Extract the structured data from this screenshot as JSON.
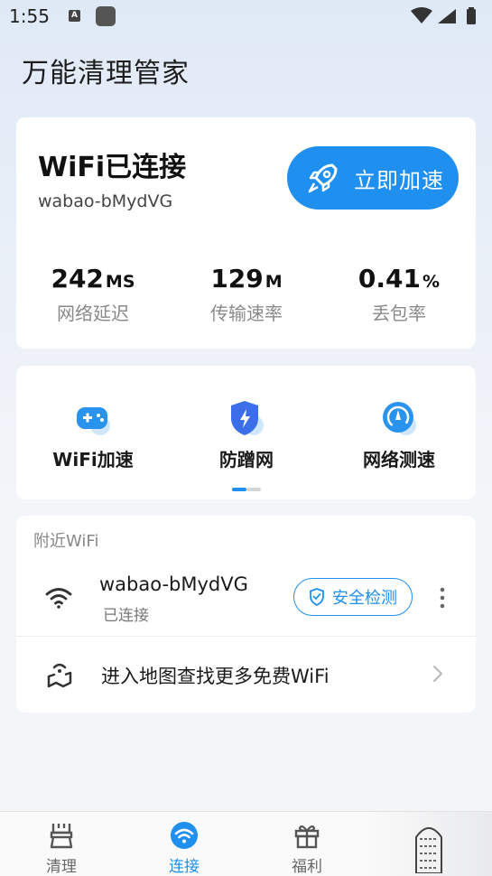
{
  "status_bar": {
    "time": "1:55",
    "notification_badge": "A"
  },
  "app": {
    "title": "万能清理管家"
  },
  "connection": {
    "status": "WiFi已连接",
    "ssid": "wabao-bMydVG",
    "boost_label": "立即加速",
    "stats": [
      {
        "value": "242",
        "unit": "MS",
        "label": "网络延迟"
      },
      {
        "value": "129",
        "unit": "M",
        "label": "传输速率"
      },
      {
        "value": "0.41",
        "unit": "%",
        "label": "丢包率"
      }
    ]
  },
  "tools": [
    {
      "label": "WiFi加速",
      "icon": "gamepad-icon"
    },
    {
      "label": "防蹭网",
      "icon": "shield-bolt-icon"
    },
    {
      "label": "网络测速",
      "icon": "speedometer-icon"
    }
  ],
  "nearby": {
    "title": "附近WiFi",
    "network": {
      "name": "wabao-bMydVG",
      "state": "已连接",
      "check_label": "安全检测"
    },
    "map_label": "进入地图查找更多免费WiFi"
  },
  "tabs": [
    {
      "label": "清理",
      "icon": "broom-icon",
      "active": false
    },
    {
      "label": "连接",
      "icon": "wifi-icon",
      "active": true
    },
    {
      "label": "福利",
      "icon": "gift-icon",
      "active": false
    }
  ],
  "colors": {
    "accent": "#1f8ff0",
    "background": "#f3f5f9"
  }
}
